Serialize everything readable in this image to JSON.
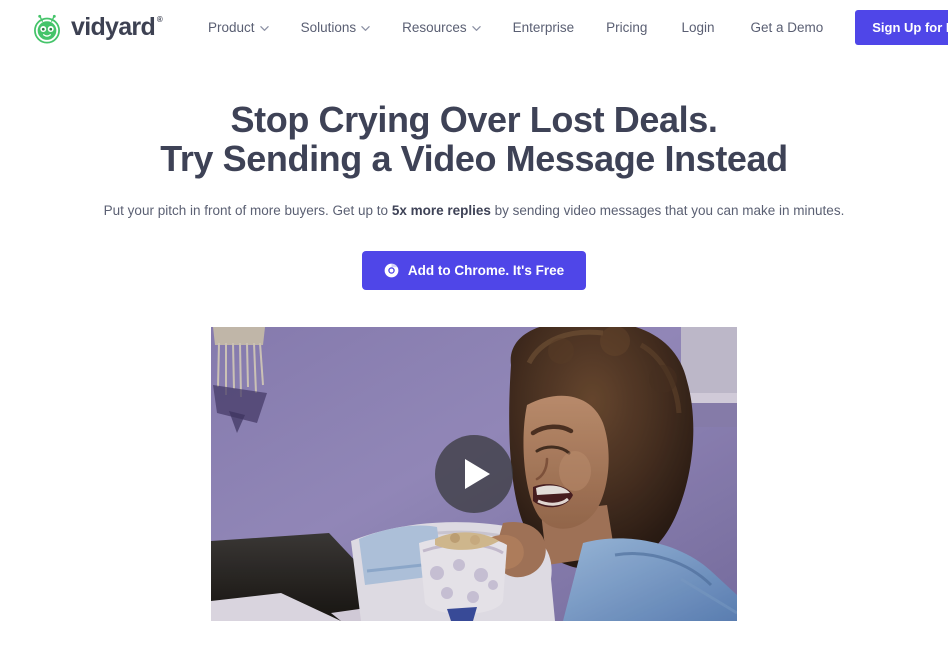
{
  "header": {
    "brand": {
      "name": "vidyard",
      "trademark": "®",
      "logo_icon": "vidyard-mascot-icon",
      "color": "#3d4152",
      "mascot_color": "#45c46a"
    },
    "nav": [
      {
        "label": "Product",
        "has_dropdown": true,
        "icon": "chevron-down-icon"
      },
      {
        "label": "Solutions",
        "has_dropdown": true,
        "icon": "chevron-down-icon"
      },
      {
        "label": "Resources",
        "has_dropdown": true,
        "icon": "chevron-down-icon"
      },
      {
        "label": "Enterprise",
        "has_dropdown": false
      },
      {
        "label": "Pricing",
        "has_dropdown": false
      }
    ],
    "login_label": "Login",
    "demo_label": "Get a Demo",
    "signup_label": "Sign Up for Free",
    "accent_color": "#4f46e8"
  },
  "hero": {
    "title_line1": "Stop Crying Over Lost Deals.",
    "title_line2": "Try Sending a Video Message Instead",
    "sub_before": "Put your pitch in front of more buyers. Get up to ",
    "sub_bold": "5x more replies",
    "sub_after": " by sending video messages that you can make in minutes.",
    "cta_label": "Add to Chrome. It's Free",
    "cta_icon": "chrome-icon",
    "title_color": "#3e4256"
  },
  "video": {
    "play_icon": "play-button-icon",
    "description": "Woman on couch crying while eating from a bowl, purple wall background"
  }
}
